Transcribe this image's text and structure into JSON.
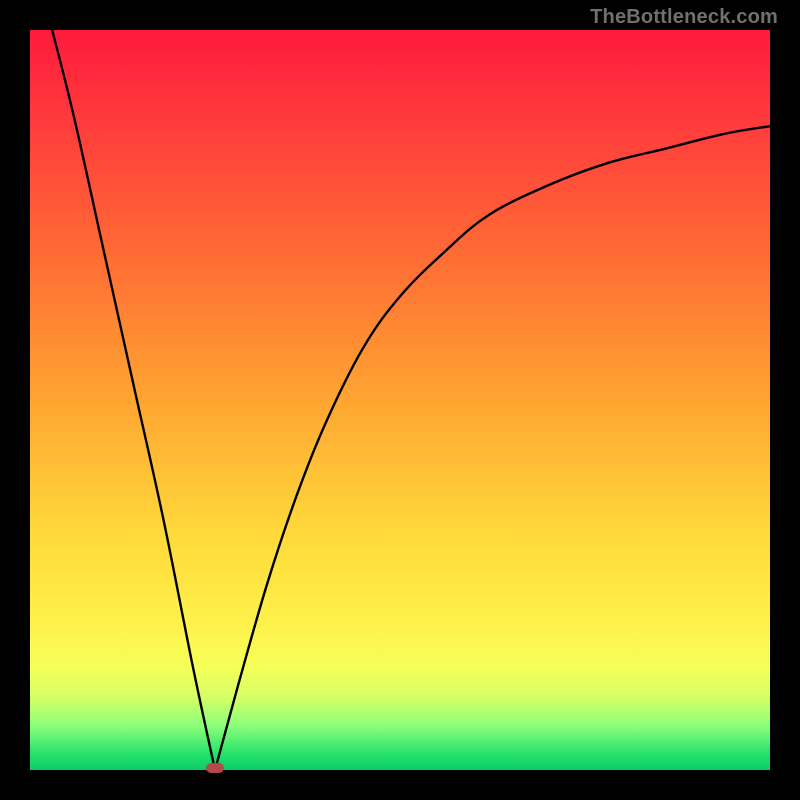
{
  "watermark": "TheBottleneck.com",
  "colors": {
    "page_bg": "#000000",
    "gradient_top": "#ff1a3c",
    "gradient_mid1": "#ff6a35",
    "gradient_mid2": "#ffd93a",
    "gradient_bottom": "#0ecb6b",
    "curve": "#000000",
    "marker": "#b24a4a"
  },
  "chart_data": {
    "type": "line",
    "title": "",
    "xlabel": "",
    "ylabel": "",
    "xlim": [
      0,
      100
    ],
    "ylim": [
      0,
      100
    ],
    "grid": false,
    "legend": false,
    "series": [
      {
        "name": "left-branch",
        "x": [
          3,
          6,
          10,
          14,
          18,
          22,
          25
        ],
        "values": [
          100,
          88,
          70,
          52,
          34,
          14,
          0
        ]
      },
      {
        "name": "right-branch",
        "x": [
          25,
          28,
          32,
          36,
          40,
          45,
          50,
          56,
          62,
          70,
          78,
          86,
          94,
          100
        ],
        "values": [
          0,
          11,
          25,
          37,
          47,
          57,
          64,
          70,
          75,
          79,
          82,
          84,
          86,
          87
        ]
      }
    ],
    "marker": {
      "x": 25,
      "y": 0
    },
    "notes": "Axes are unlabeled; values are read off relative to the plotting rectangle where (0,0) is bottom-left and (100,100) is top-right. The curve reaches the top edge at x≈3, dips to the bottom near x≈25 (red marker), then rises and asymptotically flattens near y≈87 at the right edge."
  }
}
